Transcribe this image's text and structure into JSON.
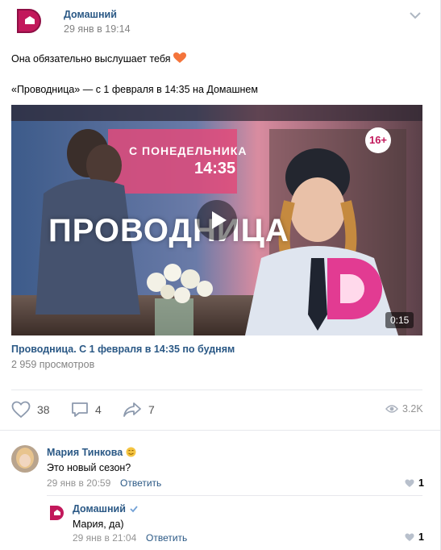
{
  "post": {
    "group_name": "Домашний",
    "date": "29 янв в 19:14",
    "text_line1": "Она обязательно выслушает тебя",
    "text_line2": "«Проводница» — с 1 февраля в 14:35 на Домашнем"
  },
  "video": {
    "overlay_sub1": "С ПОНЕДЕЛЬНИКА",
    "overlay_sub2": "14:35",
    "overlay_title": "ПРОВОДНИЦА",
    "age_rating": "16+",
    "duration": "0:15",
    "title": "Проводница. С 1 февраля в 14:35 по будням",
    "views": "2 959 просмотров"
  },
  "actions": {
    "likes": "38",
    "comments": "4",
    "shares": "7",
    "views": "3.2K"
  },
  "comments": [
    {
      "author": "Мария Тинкова",
      "text": "Это новый сезон?",
      "date": "29 янв в 20:59",
      "reply_label": "Ответить",
      "likes": "1"
    },
    {
      "author": "Домашний",
      "text": "Мария, да)",
      "date": "29 янв в 21:04",
      "reply_label": "Ответить",
      "likes": "1"
    }
  ],
  "colors": {
    "link": "#2a5885",
    "brand": "#c2185b",
    "muted": "#828282"
  }
}
